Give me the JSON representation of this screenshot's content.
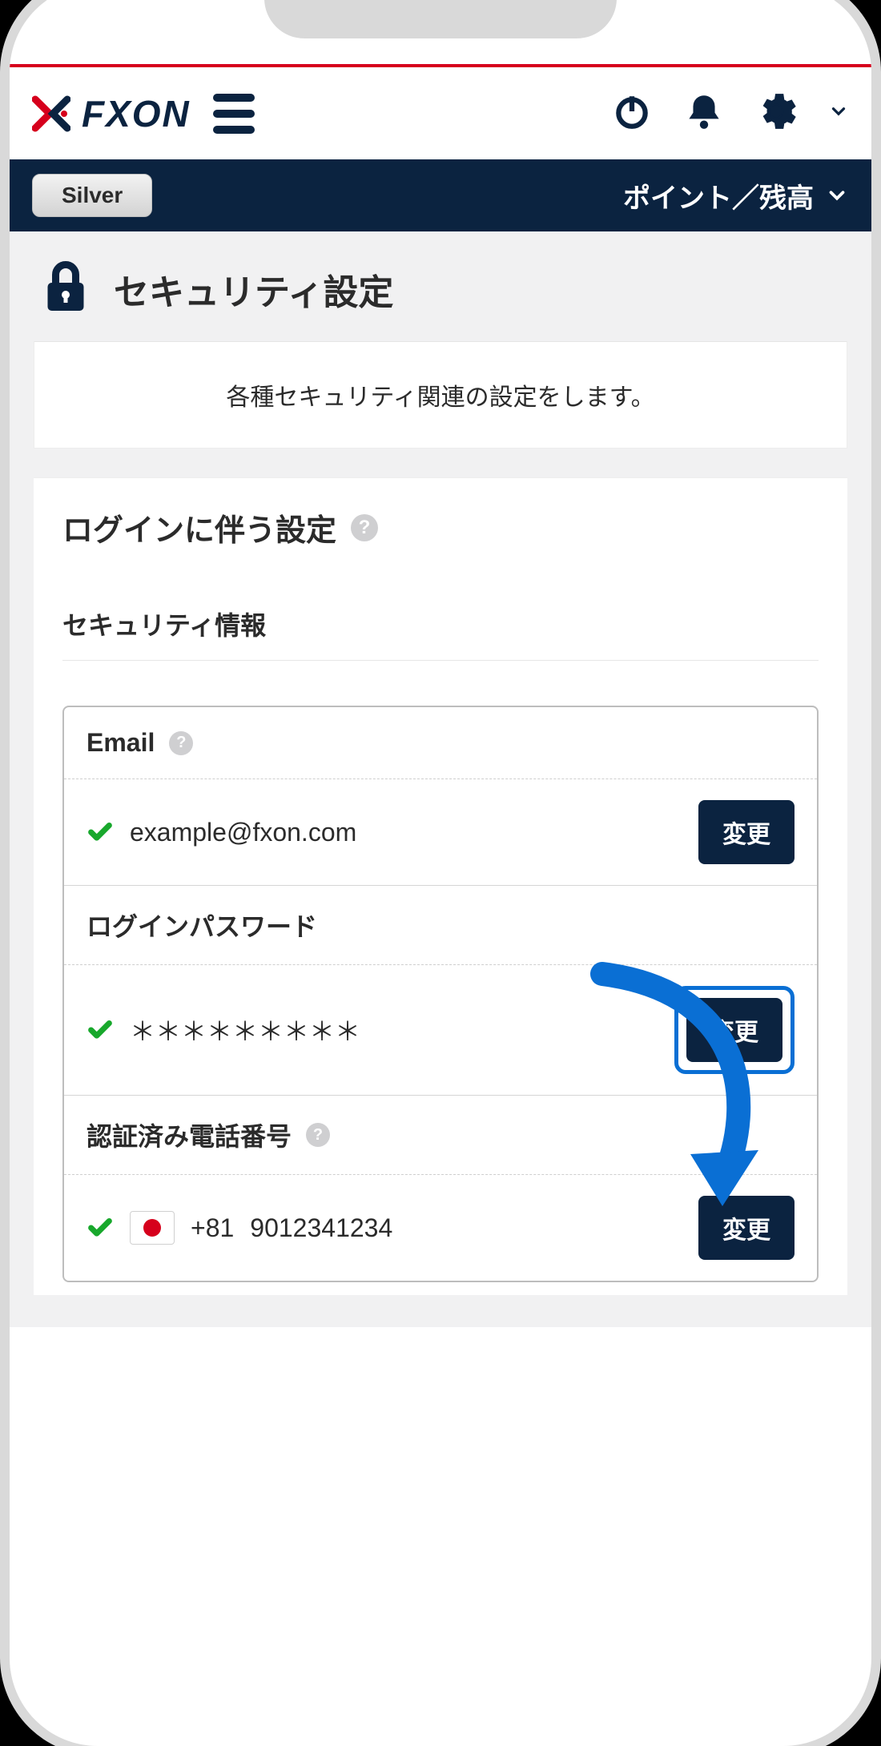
{
  "brand": {
    "name": "FXON"
  },
  "header": {
    "badge": "Silver",
    "points_label": "ポイント／残高"
  },
  "page": {
    "title": "セキュリティ設定",
    "desc": "各種セキュリティ関連の設定をします。"
  },
  "section": {
    "login_title": "ログインに伴う設定",
    "subsection": "セキュリティ情報"
  },
  "rows": {
    "email": {
      "label": "Email",
      "value": "example@fxon.com",
      "action": "変更"
    },
    "password": {
      "label": "ログインパスワード",
      "value": "＊＊＊＊＊＊＊＊＊",
      "action": "変更"
    },
    "phone": {
      "label": "認証済み電話番号",
      "dial": "+81",
      "number": "9012341234",
      "action": "変更"
    }
  }
}
